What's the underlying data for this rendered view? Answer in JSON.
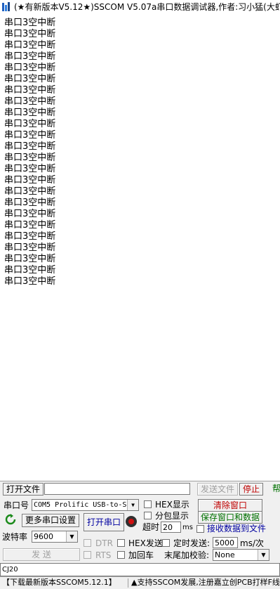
{
  "window": {
    "title": "(★有新版本V5.12★)SSCOM V5.07a串口数据调试器,作者:习小猛(大虾"
  },
  "receive": {
    "lines": [
      "串口3空中断",
      "串口3空中断",
      "串口3空中断",
      "串口3空中断",
      "串口3空中断",
      "串口3空中断",
      "串口3空中断",
      "串口3空中断",
      "串口3空中断",
      "串口3空中断",
      "串口3空中断",
      "串口3空中断",
      "串口3空中断",
      "串口3空中断",
      "串口3空中断",
      "串口3空中断",
      "串口3空中断",
      "串口3空中断",
      "串口3空中断",
      "串口3空中断",
      "串口3空中断",
      "串口3空中断",
      "串口3空中断",
      "串口3空中断"
    ]
  },
  "file_row": {
    "open_file": "打开文件",
    "file_path": "",
    "send_file": "发送文件",
    "stop": "停止",
    "cut_label": "帮"
  },
  "port": {
    "label": "串口号",
    "value": "COM5 Prolific USB-to-S",
    "more_ports": "更多串口设置",
    "open_port": "打开串口",
    "baud_label": "波特率",
    "baud_value": "9600"
  },
  "options": {
    "hex_display": "HEX显示",
    "split_display": "分包显示",
    "timeout_label": "超时",
    "timeout_value": "20",
    "timeout_unit": "ms",
    "clear_window": "清除窗口",
    "save_window": "保存窗口和数据",
    "recv_to_file": "接收数据到文件",
    "dtr": "DTR",
    "rts": "RTS",
    "hex_send": "HEX发送",
    "timed_send": "定时发送:",
    "timed_value": "5000",
    "timed_unit": "ms/次",
    "add_cr": "加回车",
    "checksum_label": "末尾加校验:",
    "checksum_value": "None",
    "send": "发 送"
  },
  "send_input": {
    "value": "CJ20"
  },
  "status": {
    "download": "【下载最新版本SSCOM5.12.1】",
    "notice": "▲支持SSCOM发展,注册嘉立创PCB打样F线"
  },
  "colors": {
    "red_text": "#c00000",
    "green_text": "#007000",
    "blue_text": "#0000a0"
  },
  "icons": [
    "refresh-icon",
    "port-status-icon",
    "app-icon",
    "dropdown-arrow-icon"
  ]
}
